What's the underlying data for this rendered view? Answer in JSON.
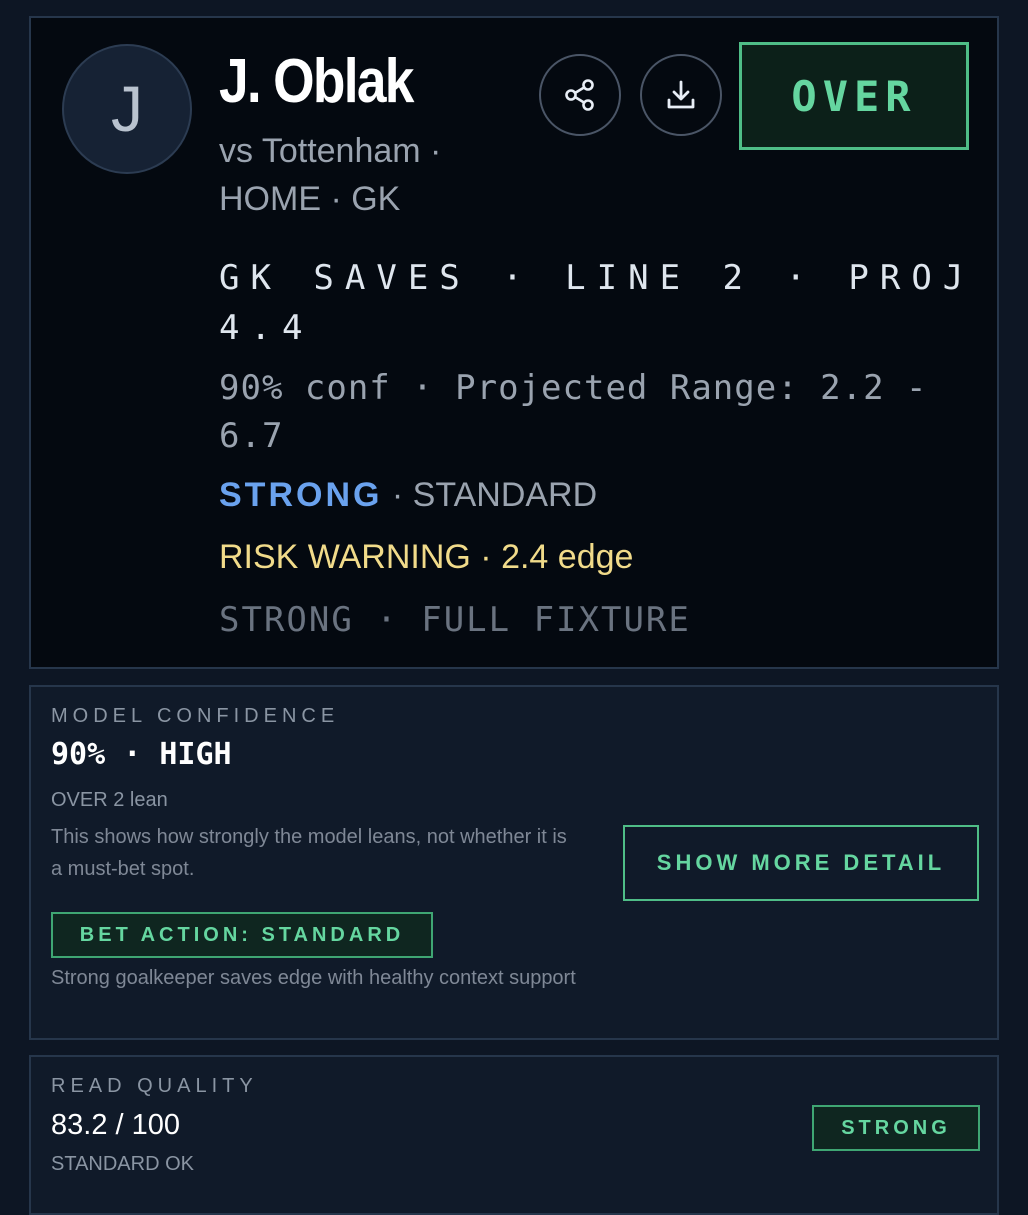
{
  "player": {
    "initial": "J",
    "name": "J. Oblak",
    "subline_1": "vs Tottenham ·",
    "subline_2": "HOME · GK"
  },
  "actions": {
    "share_icon": "share-icon",
    "download_icon": "download-icon"
  },
  "pick": {
    "direction": "OVER"
  },
  "stat": {
    "line_1": "GK SAVES · LINE 2 · PROJ",
    "line_2": "4.4"
  },
  "range": {
    "line_1": "90% conf · Projected Range: 2.2 -",
    "line_2": "6.7"
  },
  "tier": {
    "strength": "STRONG",
    "rest": " · STANDARD"
  },
  "risk": {
    "text": "RISK WARNING · 2.4 edge"
  },
  "fixture": {
    "text": "STRONG · FULL FIXTURE"
  },
  "model_confidence": {
    "label": "MODEL CONFIDENCE",
    "value": "90% · HIGH",
    "lean": "OVER 2 lean",
    "description": "This shows how strongly the model leans, not whether it is a must-bet spot.",
    "detail_button": "SHOW MORE DETAIL",
    "bet_action": "BET ACTION: STANDARD",
    "bet_description": "Strong goalkeeper saves edge with healthy context support"
  },
  "read_quality": {
    "label": "READ QUALITY",
    "value": "83.2 / 100",
    "sub": "STANDARD OK",
    "badge": "STRONG"
  },
  "colors": {
    "accent_green": "#65d6a0",
    "strong_blue": "#6aa2ee",
    "warning_yellow": "#f1db8a",
    "background": "#0d1624"
  }
}
